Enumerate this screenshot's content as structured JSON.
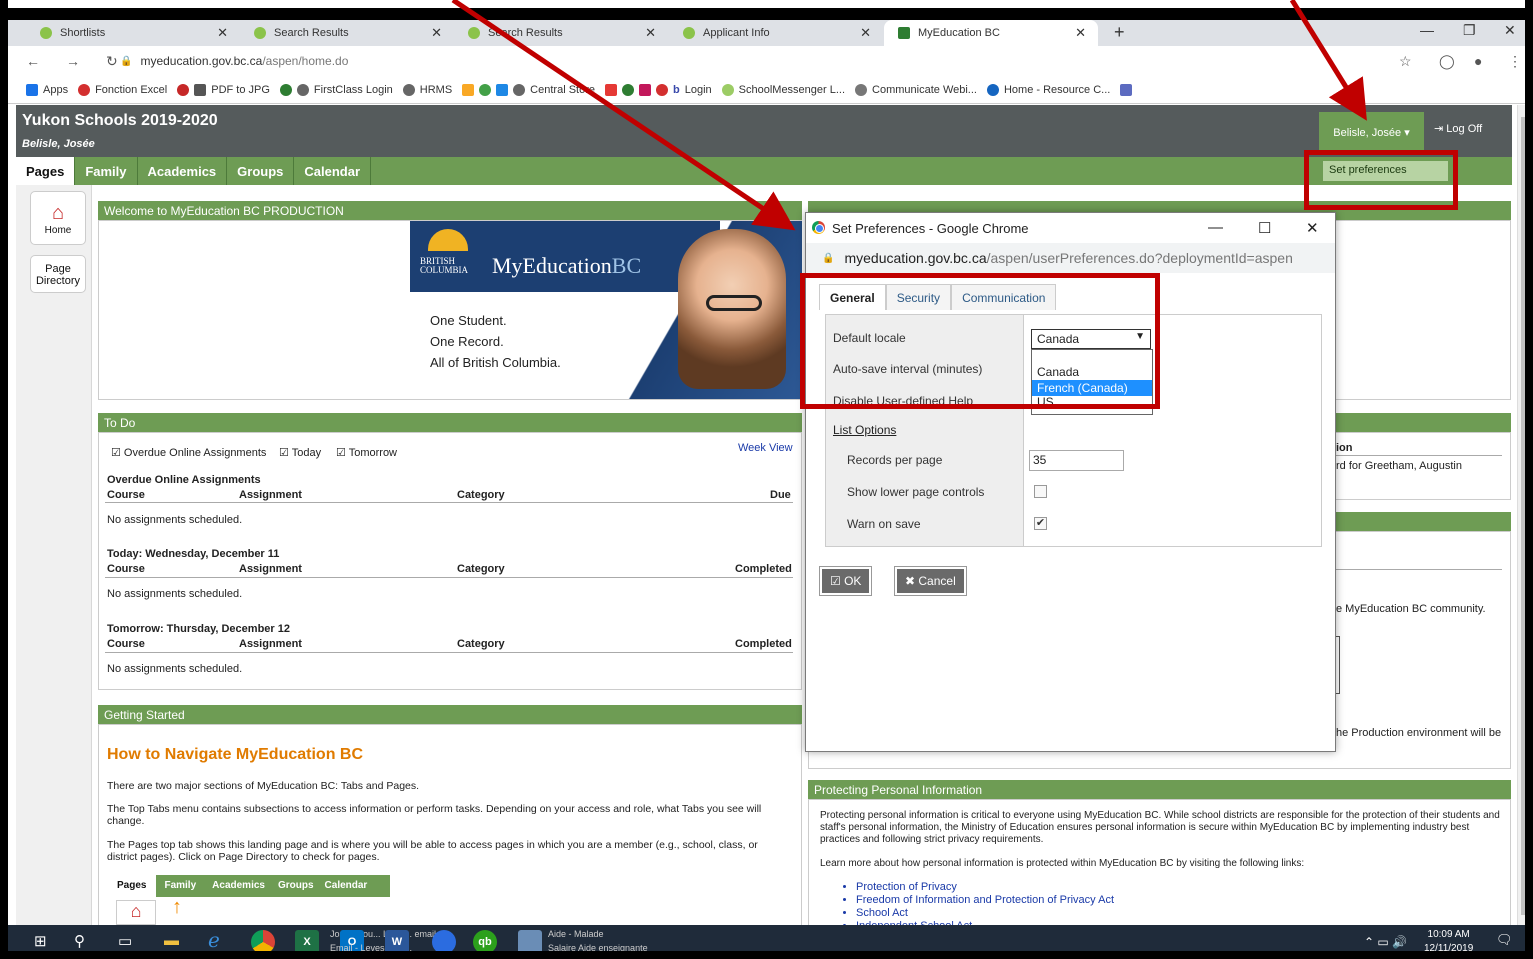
{
  "browser": {
    "tabs": [
      {
        "title": "Shortlists"
      },
      {
        "title": "Search Results"
      },
      {
        "title": "Search Results"
      },
      {
        "title": "Applicant Info"
      },
      {
        "title": "MyEducation BC",
        "active": true
      }
    ],
    "new_tab": "+",
    "url_host": "myeducation.gov.bc.ca",
    "url_path": "/aspen/home.do",
    "bookmarks": [
      "Apps",
      "Fonction Excel",
      "PDF to JPG",
      "FirstClass Login",
      "HRMS",
      "Central Store",
      "Login",
      "SchoolMessenger L...",
      "Communicate Webi...",
      "Home - Resource C..."
    ]
  },
  "app": {
    "school": "Yukon Schools 2019-2020",
    "user": "Belisle, Josée",
    "user_menu": "Belisle, Josée ▾",
    "logoff": "Log Off",
    "set_preferences": "Set preferences",
    "top_tabs": [
      "Pages",
      "Family",
      "Academics",
      "Groups",
      "Calendar"
    ],
    "left_nav": {
      "home": "Home",
      "page_dir": "Page Directory"
    }
  },
  "welcome": {
    "header": "Welcome to MyEducation BC PRODUCTION",
    "logo_bc": "BRITISH\nCOLUMBIA",
    "logo_main": "MyEducation",
    "logo_bc2": "BC",
    "slogan": [
      "One Student.",
      "One Record.",
      "All of British Columbia."
    ]
  },
  "todo": {
    "header": "To Do",
    "filters": [
      "Overdue Online Assignments",
      "Today",
      "Tomorrow"
    ],
    "week_view": "Week View",
    "sections": [
      {
        "title": "Overdue Online Assignments",
        "cols": [
          "Course",
          "Assignment",
          "Category",
          "Due"
        ],
        "empty": "No assignments scheduled."
      },
      {
        "title": "Today: Wednesday, December 11",
        "cols": [
          "Course",
          "Assignment",
          "Category",
          "Completed"
        ],
        "empty": "No assignments scheduled."
      },
      {
        "title": "Tomorrow: Thursday, December 12",
        "cols": [
          "Course",
          "Assignment",
          "Category",
          "Completed"
        ],
        "empty": "No assignments scheduled."
      }
    ]
  },
  "getting_started": {
    "header": "Getting Started",
    "title": "How to Navigate MyEducation BC",
    "p1": "There are two major sections of MyEducation BC: Tabs and Pages.",
    "p2_b": "Top Tabs",
    "p2": "The Top Tabs menu contains subsections to access information or perform tasks. Depending on your access and role, what Tabs you see will change.",
    "p3": "The Pages top tab shows this landing page and is where you will be able to access pages in which you are a member (e.g., school, class, or district pages). Click on Page Directory to check for pages.",
    "mini_tabs": [
      "Pages",
      "Family",
      "Academics",
      "Groups",
      "Calendar"
    ]
  },
  "right_fragments": {
    "col_head": "ion",
    "award": "rd for Greetham, Augustin",
    "community": "e MyEducation BC community.",
    "production": "he Production environment will be"
  },
  "privacy": {
    "header": "Protecting Personal Information",
    "p1": "Protecting personal information is critical to everyone using MyEducation BC. While school districts are responsible for the protection of their students and staff's personal information, the Ministry of Education ensures personal information is secure within MyEducation BC by implementing industry best practices and following strict privacy requirements.",
    "p2": "Learn more about how personal information is protected within MyEducation BC by visiting the following links:",
    "links": [
      "Protection of Privacy",
      "Freedom of Information and Protection of Privacy Act",
      "School Act",
      "Independent School Act"
    ]
  },
  "dialog": {
    "title": "Set Preferences - Google Chrome",
    "url_host": "myeducation.gov.bc.ca",
    "url_path": "/aspen/userPreferences.do?deploymentId=aspen",
    "tabs": [
      "General",
      "Security",
      "Communication"
    ],
    "labels": {
      "locale": "Default locale",
      "autosave": "Auto-save interval (minutes)",
      "help": "Disable User-defined Help",
      "list_options": "List Options",
      "records": "Records per page",
      "lower": "Show lower page controls",
      "warn": "Warn on save"
    },
    "locale_value": "Canada",
    "locale_options": [
      "Canada",
      "French (Canada)",
      "US"
    ],
    "records_value": "35",
    "lower_checked": false,
    "warn_checked": true,
    "ok": "OK",
    "cancel": "Cancel"
  },
  "taskbar": {
    "time": "10:09 AM",
    "date": "12/11/2019",
    "apps": [
      "excel",
      "outlook",
      "word",
      "quickbooks"
    ],
    "email_label": "Josée Dou... Louis... email",
    "email_sub": "Email - Levesque, ...",
    "task2": "Aide - Malade",
    "task2_sub": "Salaire Aide enseignante"
  },
  "colors": {
    "green": "#6e9c54",
    "header_gray": "#555b5c",
    "annotation_red": "#c00000",
    "navy": "#1c3f72"
  }
}
